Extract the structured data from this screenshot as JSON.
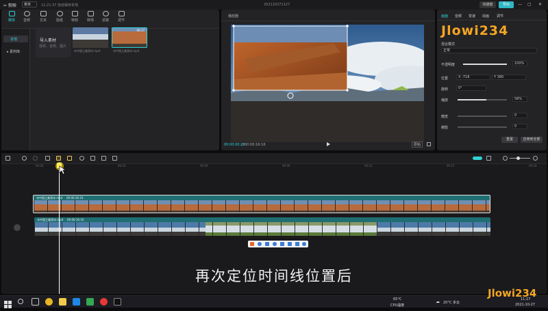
{
  "titlebar": {
    "logo": "✂ 剪映",
    "menu_label": "菜单",
    "status": "11:21:37 自动保存本地",
    "project_name": "202110271127",
    "shortcut_label": "快捷键",
    "export_label": "导出"
  },
  "media_tools": [
    {
      "label": "媒体",
      "icon": "media-icon"
    },
    {
      "label": "音频",
      "icon": "audio-icon"
    },
    {
      "label": "文本",
      "icon": "text-icon"
    },
    {
      "label": "贴纸",
      "icon": "sticker-icon"
    },
    {
      "label": "特效",
      "icon": "effects-icon"
    },
    {
      "label": "转场",
      "icon": "transition-icon"
    },
    {
      "label": "滤镜",
      "icon": "filter-icon"
    },
    {
      "label": "调节",
      "icon": "adjust-icon"
    }
  ],
  "media_sidebar": {
    "items": [
      "本地",
      "▸ 素材库"
    ]
  },
  "import": {
    "label": "导入素材",
    "hint": "视频、音频、图片"
  },
  "media_clips": [
    {
      "name": "冰中国之美滑冰.mp4",
      "duration": ""
    },
    {
      "name": "冰中国之美滑冰.mp4",
      "duration": "00:17"
    }
  ],
  "player": {
    "title": "播放器",
    "current_time": "00:00:00:28",
    "total_time": "00:00:16:16",
    "ratio_label": "原始"
  },
  "inspector": {
    "tabs": [
      "画面",
      "音频",
      "变速",
      "动画",
      "调节"
    ],
    "logo_text": "Jlowi234",
    "blend_mode_label": "混合模式",
    "blend_mode_value": "正常",
    "opacity_label": "不透明度",
    "opacity_value": "100%",
    "opacity_level": 1.0,
    "position_label": "位置",
    "position_x_label": "X",
    "position_x": "-718",
    "position_y_label": "Y",
    "position_y": "380",
    "rotation_label": "旋转",
    "rotation_value": "0°",
    "scale_label": "缩放",
    "scale_value": "58%",
    "scale_level": 0.58,
    "smart_label": "磨皮",
    "smart_value": "0",
    "thin_label": "瘦脸",
    "thin_value": "0",
    "reset_label": "重置",
    "apply_all_label": "应用到全部"
  },
  "timeline": {
    "ruler_labels": [
      "00:00",
      "00:03",
      "00:06",
      "00:09",
      "00:12",
      "00:15",
      "00:18"
    ],
    "upper_clip": {
      "name": "冰中国之美滑冰.mp4",
      "duration": "00:00:16:16"
    },
    "lower_clip": {
      "name": "冰中国之美滑冰.mp4",
      "duration": "00:00:16:16"
    }
  },
  "subtitle": "再次定位时间线位置后",
  "taskbar": {
    "temperature": "65°C",
    "cpu_label": "CPU温度",
    "weather": "20°C 多云",
    "time": "11:27",
    "date": "2021-10-27"
  },
  "watermark": "Jlowi234",
  "colors": {
    "accent": "#2fd3d6",
    "clip_teal": "#1f6e72",
    "panel": "#232326"
  }
}
